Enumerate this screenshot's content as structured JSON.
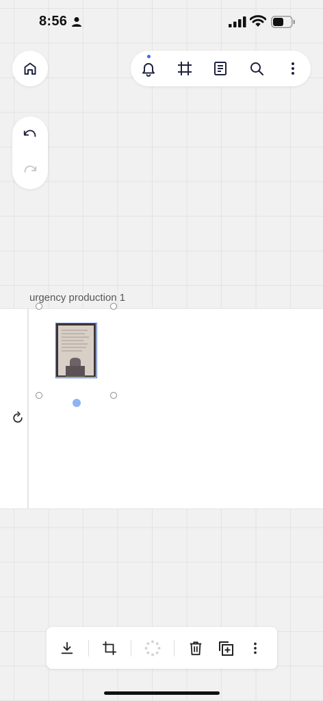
{
  "status_bar": {
    "time": "8:56",
    "person_icon": "person-icon",
    "signal_icon": "cellular-signal-icon",
    "wifi_icon": "wifi-icon",
    "battery_icon": "battery-icon"
  },
  "nav": {
    "home_icon": "home-icon",
    "top_toolbar": [
      "bell-icon",
      "frames-icon",
      "notes-icon",
      "search-icon",
      "more-vertical-icon"
    ],
    "history": [
      "undo-icon",
      "redo-icon"
    ]
  },
  "board": {
    "frame_title": "urgency production 1",
    "selected_item": "photo-of-document",
    "rotate_icon": "rotate-icon"
  },
  "bottom_toolbar": [
    "download-icon",
    "crop-icon",
    "loading-spinner-icon",
    "trash-icon",
    "duplicate-icon",
    "more-vertical-icon"
  ],
  "colors": {
    "accent": "#4262ff",
    "selection": "#4a7bd6",
    "handle_blue": "#8fb3f5",
    "canvas": "#f1f1f1",
    "icon": "#1f2140"
  }
}
